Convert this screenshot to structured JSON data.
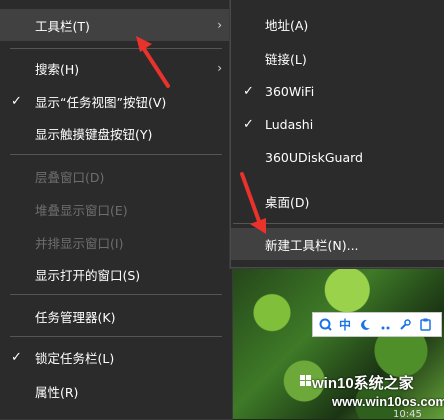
{
  "main_menu": {
    "items": [
      {
        "label": "工具栏(T)",
        "checked": false,
        "submenu": true,
        "disabled": false,
        "highlighted": true
      },
      {
        "label": "搜索(H)",
        "checked": false,
        "submenu": true,
        "disabled": false,
        "highlighted": false
      },
      {
        "label": "显示“任务视图”按钮(V)",
        "checked": true,
        "submenu": false,
        "disabled": false,
        "highlighted": false
      },
      {
        "label": "显示触摸键盘按钮(Y)",
        "checked": false,
        "submenu": false,
        "disabled": false,
        "highlighted": false
      },
      {
        "label": "层叠窗口(D)",
        "checked": false,
        "submenu": false,
        "disabled": true,
        "highlighted": false
      },
      {
        "label": "堆叠显示窗口(E)",
        "checked": false,
        "submenu": false,
        "disabled": true,
        "highlighted": false
      },
      {
        "label": "并排显示窗口(I)",
        "checked": false,
        "submenu": false,
        "disabled": true,
        "highlighted": false
      },
      {
        "label": "显示打开的窗口(S)",
        "checked": false,
        "submenu": false,
        "disabled": false,
        "highlighted": false
      },
      {
        "label": "任务管理器(K)",
        "checked": false,
        "submenu": false,
        "disabled": false,
        "highlighted": false
      },
      {
        "label": "锁定任务栏(L)",
        "checked": true,
        "submenu": false,
        "disabled": false,
        "highlighted": false
      },
      {
        "label": "属性(R)",
        "checked": false,
        "submenu": false,
        "disabled": false,
        "highlighted": false
      }
    ]
  },
  "toolbar_submenu": {
    "items": [
      {
        "label": "地址(A)",
        "checked": false,
        "highlighted": false
      },
      {
        "label": "链接(L)",
        "checked": false,
        "highlighted": false
      },
      {
        "label": "360WiFi",
        "checked": true,
        "highlighted": false
      },
      {
        "label": "Ludashi",
        "checked": true,
        "highlighted": false
      },
      {
        "label": "360UDiskGuard",
        "checked": false,
        "highlighted": false
      },
      {
        "label": "桌面(D)",
        "checked": false,
        "highlighted": false
      },
      {
        "label": "新建工具栏(N)...",
        "checked": false,
        "highlighted": true
      }
    ]
  },
  "glyphs": {
    "check": "✓",
    "submenu_arrow": "›"
  },
  "ime_bar": {
    "mode": "中",
    "icons": [
      "search-icon",
      "moon-icon",
      "punctuation-icon",
      "wrench-icon",
      "clipboard-icon"
    ]
  },
  "watermark": {
    "line1": "win10系统之家",
    "line2": "www.win10os.com"
  },
  "clock": {
    "time": "10:45"
  },
  "colors": {
    "menu_bg": "#2b2b2b",
    "highlight": "#414141",
    "disabled_text": "#6e6e6e",
    "annotation_arrow": "#e8322b"
  }
}
